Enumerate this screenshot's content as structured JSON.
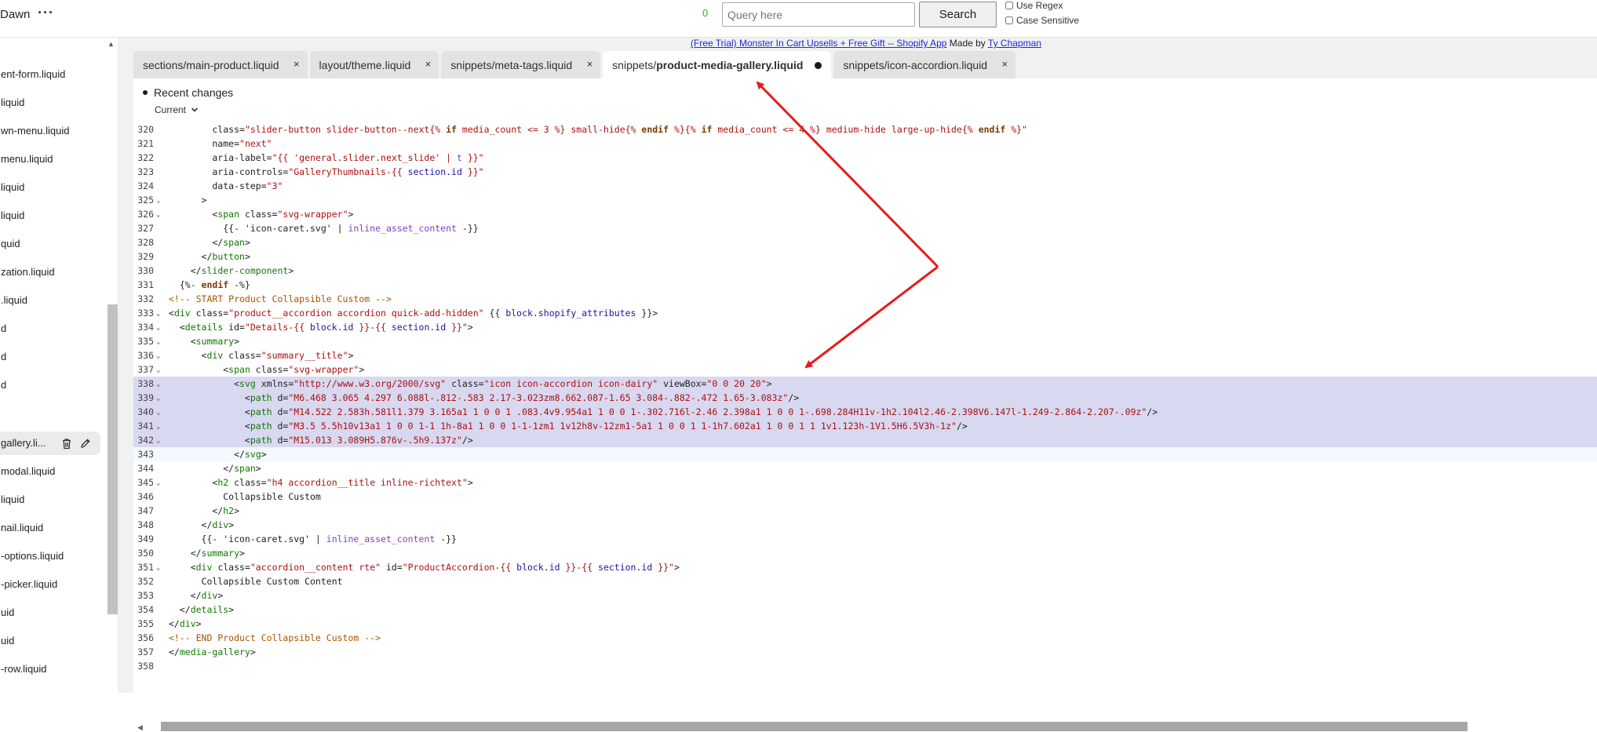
{
  "topbar": {
    "store_name": "Dawn",
    "more_label": "···",
    "match_count": "0",
    "query_placeholder": "Query here",
    "search_label": "Search",
    "use_regex_label": "Use Regex",
    "case_sensitive_label": "Case Sensitive"
  },
  "sidebar": {
    "items": [
      {
        "label": "ent-form.liquid"
      },
      {
        "label": "liquid"
      },
      {
        "label": "wn-menu.liquid"
      },
      {
        "label": "menu.liquid"
      },
      {
        "label": "liquid"
      },
      {
        "label": "liquid"
      },
      {
        "label": "quid"
      },
      {
        "label": "zation.liquid"
      },
      {
        "label": ".liquid"
      },
      {
        "label": "d"
      },
      {
        "label": "d"
      },
      {
        "label": "d"
      },
      {
        "label": ""
      },
      {
        "label": "gallery.li..."
      },
      {
        "label": "modal.liquid"
      },
      {
        "label": "liquid"
      },
      {
        "label": "nail.liquid"
      },
      {
        "label": "-options.liquid"
      },
      {
        "label": "-picker.liquid"
      },
      {
        "label": "uid"
      },
      {
        "label": "uid"
      },
      {
        "label": "-row.liquid"
      }
    ]
  },
  "promo": {
    "link_text": "(Free Trial) Monster In Cart Upsells + Free Gift -- Shopify App",
    "made_by": " Made by ",
    "author": "Ty Chapman"
  },
  "tabs": [
    {
      "prefix": "sections/",
      "name": "main-product.liquid",
      "close": "×"
    },
    {
      "prefix": "layout/",
      "name": "theme.liquid",
      "close": "×"
    },
    {
      "prefix": "snippets/",
      "name": "meta-tags.liquid",
      "close": "×"
    },
    {
      "prefix": "snippets/",
      "name": "product-media-gallery.liquid",
      "close": ""
    },
    {
      "prefix": "snippets/",
      "name": "icon-accordion.liquid",
      "close": "×"
    }
  ],
  "recent": {
    "title": "Recent changes",
    "dropdown": "Current"
  },
  "colors": {
    "tag": "#117700",
    "attr": "#0000cc",
    "string": "#aa1111",
    "liquid_var": "#221199",
    "filter": "#7f3fbf",
    "comment": "#aa5500",
    "highlight": "#d8d8f0",
    "arrow": "#e51c1c"
  },
  "code_lines": [
    {
      "n": "320",
      "fold": "",
      "text": "        class=\"slider-button slider-button--next{% if media_count <= 3 %} small-hide{% endif %}{% if media_count <= 4 %} medium-hide large-up-hide{% endif %}\""
    },
    {
      "n": "321",
      "fold": "",
      "text": "        name=\"next\""
    },
    {
      "n": "322",
      "fold": "",
      "text": "        aria-label=\"{{ 'general.slider.next_slide' | t }}\""
    },
    {
      "n": "323",
      "fold": "",
      "text": "        aria-controls=\"GalleryThumbnails-{{ section.id }}\""
    },
    {
      "n": "324",
      "fold": "",
      "text": "        data-step=\"3\""
    },
    {
      "n": "325",
      "fold": "⌄",
      "text": "      >"
    },
    {
      "n": "326",
      "fold": "⌄",
      "text": "        <span class=\"svg-wrapper\">"
    },
    {
      "n": "327",
      "fold": "",
      "text": "          {{- 'icon-caret.svg' | inline_asset_content -}}"
    },
    {
      "n": "328",
      "fold": "",
      "text": "        </span>"
    },
    {
      "n": "329",
      "fold": "",
      "text": "      </button>"
    },
    {
      "n": "330",
      "fold": "",
      "text": "    </slider-component>"
    },
    {
      "n": "331",
      "fold": "",
      "text": "  {%- endif -%}"
    },
    {
      "n": "332",
      "fold": "",
      "text": "<!-- START Product Collapsible Custom -->"
    },
    {
      "n": "333",
      "fold": "⌄",
      "text": "<div class=\"product__accordion accordion quick-add-hidden\" {{ block.shopify_attributes }}>"
    },
    {
      "n": "334",
      "fold": "⌄",
      "text": "  <details id=\"Details-{{ block.id }}-{{ section.id }}\">"
    },
    {
      "n": "335",
      "fold": "⌄",
      "text": "    <summary>"
    },
    {
      "n": "336",
      "fold": "⌄",
      "text": "      <div class=\"summary__title\">"
    },
    {
      "n": "337",
      "fold": "⌄",
      "text": "          <span class=\"svg-wrapper\">"
    },
    {
      "n": "338",
      "fold": "⌄",
      "text": "            <svg xmlns=\"http://www.w3.org/2000/svg\" class=\"icon icon-accordion icon-dairy\" viewBox=\"0 0 20 20\">"
    },
    {
      "n": "339",
      "fold": "⌄",
      "text": "              <path d=\"M6.468 3.065 4.297 6.088l-.812-.583 2.17-3.023zm8.662.087-1.65 3.084-.882-.472 1.65-3.083z\"/>"
    },
    {
      "n": "340",
      "fold": "⌄",
      "text": "              <path d=\"M14.522 2.583h.581l1.379 3.165a1 1 0 0 1 .083.4v9.954a1 1 0 0 1-.302.716l-2.46 2.398a1 1 0 0 1-.698.284H11v-1h2.104l2.46-2.398V6.147l-1.249-2.864-2.207-.09z\"/>"
    },
    {
      "n": "341",
      "fold": "⌄",
      "text": "              <path d=\"M3.5 5.5h10v13a1 1 0 0 1-1 1h-8a1 1 0 0 1-1-1zm1 1v12h8v-12zm1-5a1 1 0 0 1 1-1h7.602a1 1 0 0 1 1 1v1.123h-1V1.5H6.5V3h-1z\"/>"
    },
    {
      "n": "342",
      "fold": "⌄",
      "text": "              <path d=\"M15.013 3.089H5.876v-.5h9.137z\"/>"
    },
    {
      "n": "343",
      "fold": "",
      "text": "            </svg>"
    },
    {
      "n": "344",
      "fold": "",
      "text": "          </span>"
    },
    {
      "n": "345",
      "fold": "⌄",
      "text": "        <h2 class=\"h4 accordion__title inline-richtext\">"
    },
    {
      "n": "346",
      "fold": "",
      "text": "          Collapsible Custom"
    },
    {
      "n": "347",
      "fold": "",
      "text": "        </h2>"
    },
    {
      "n": "348",
      "fold": "",
      "text": "      </div>"
    },
    {
      "n": "349",
      "fold": "",
      "text": "      {{- 'icon-caret.svg' | inline_asset_content -}}"
    },
    {
      "n": "350",
      "fold": "",
      "text": "    </summary>"
    },
    {
      "n": "351",
      "fold": "⌄",
      "text": "    <div class=\"accordion__content rte\" id=\"ProductAccordion-{{ block.id }}-{{ section.id }}\">"
    },
    {
      "n": "352",
      "fold": "",
      "text": "      Collapsible Custom Content"
    },
    {
      "n": "353",
      "fold": "",
      "text": "    </div>"
    },
    {
      "n": "354",
      "fold": "",
      "text": "  </details>"
    },
    {
      "n": "355",
      "fold": "",
      "text": "</div>"
    },
    {
      "n": "356",
      "fold": "",
      "text": "<!-- END Product Collapsible Custom -->"
    },
    {
      "n": "357",
      "fold": "",
      "text": "</media-gallery>"
    },
    {
      "n": "358",
      "fold": "",
      "text": ""
    }
  ]
}
